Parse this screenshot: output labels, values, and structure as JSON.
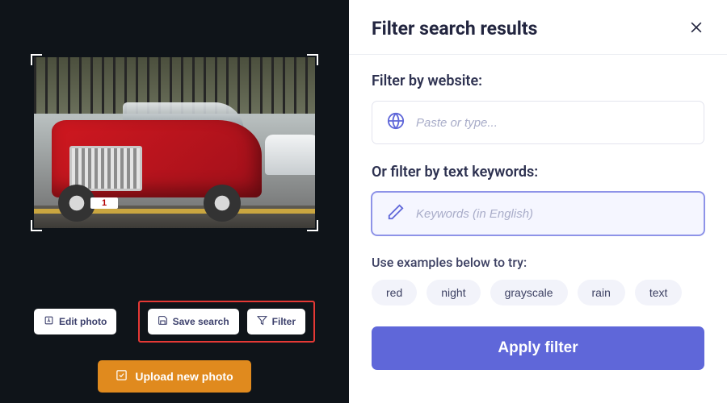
{
  "photo": {
    "plate_text": "1"
  },
  "left": {
    "edit_label": "Edit photo",
    "save_label": "Save search",
    "filter_label": "Filter",
    "upload_label": "Upload new photo"
  },
  "panel": {
    "title": "Filter search results",
    "website_label": "Filter by website:",
    "website_placeholder": "Paste or type...",
    "keywords_label": "Or filter by text keywords:",
    "keywords_placeholder": "Keywords (in English)",
    "keywords_value": "",
    "examples_label": "Use examples below to try:",
    "chips": [
      "red",
      "night",
      "grayscale",
      "rain",
      "text"
    ],
    "apply_label": "Apply filter"
  }
}
